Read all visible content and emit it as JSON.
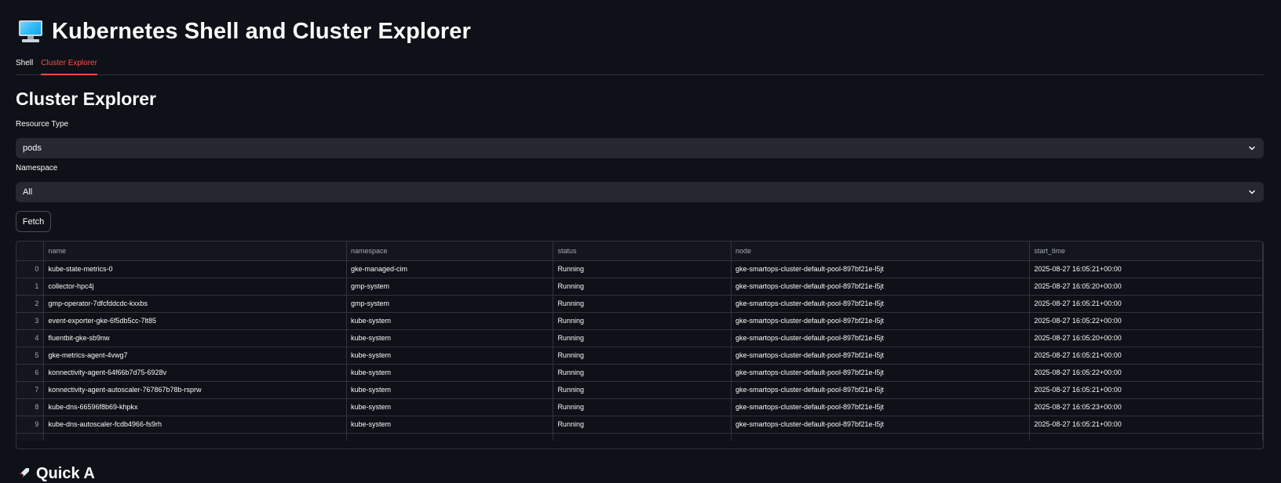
{
  "app": {
    "title": "Kubernetes Shell and Cluster Explorer",
    "icon": "monitor-icon"
  },
  "tabs": [
    {
      "label": "Shell",
      "active": false
    },
    {
      "label": "Cluster Explorer",
      "active": true
    }
  ],
  "explorer": {
    "heading": "Cluster Explorer",
    "resource_type": {
      "label": "Resource Type",
      "value": "pods"
    },
    "namespace": {
      "label": "Namespace",
      "value": "All"
    },
    "fetch_label": "Fetch"
  },
  "table": {
    "columns": [
      "name",
      "namespace",
      "status",
      "node",
      "start_time"
    ],
    "rows": [
      {
        "index": "0",
        "name": "kube-state-metrics-0",
        "namespace": "gke-managed-cim",
        "status": "Running",
        "node": "gke-smartops-cluster-default-pool-897bf21e-l5jt",
        "start_time": "2025-08-27 16:05:21+00:00"
      },
      {
        "index": "1",
        "name": "collector-hpc4j",
        "namespace": "gmp-system",
        "status": "Running",
        "node": "gke-smartops-cluster-default-pool-897bf21e-l5jt",
        "start_time": "2025-08-27 16:05:20+00:00"
      },
      {
        "index": "2",
        "name": "gmp-operator-7dfcfddcdc-kxxbs",
        "namespace": "gmp-system",
        "status": "Running",
        "node": "gke-smartops-cluster-default-pool-897bf21e-l5jt",
        "start_time": "2025-08-27 16:05:21+00:00"
      },
      {
        "index": "3",
        "name": "event-exporter-gke-6f5db5cc-7lt85",
        "namespace": "kube-system",
        "status": "Running",
        "node": "gke-smartops-cluster-default-pool-897bf21e-l5jt",
        "start_time": "2025-08-27 16:05:22+00:00"
      },
      {
        "index": "4",
        "name": "fluentbit-gke-sb9nw",
        "namespace": "kube-system",
        "status": "Running",
        "node": "gke-smartops-cluster-default-pool-897bf21e-l5jt",
        "start_time": "2025-08-27 16:05:20+00:00"
      },
      {
        "index": "5",
        "name": "gke-metrics-agent-4vwg7",
        "namespace": "kube-system",
        "status": "Running",
        "node": "gke-smartops-cluster-default-pool-897bf21e-l5jt",
        "start_time": "2025-08-27 16:05:21+00:00"
      },
      {
        "index": "6",
        "name": "konnectivity-agent-64f66b7d75-6928v",
        "namespace": "kube-system",
        "status": "Running",
        "node": "gke-smartops-cluster-default-pool-897bf21e-l5jt",
        "start_time": "2025-08-27 16:05:22+00:00"
      },
      {
        "index": "7",
        "name": "konnectivity-agent-autoscaler-767867b78b-rsprw",
        "namespace": "kube-system",
        "status": "Running",
        "node": "gke-smartops-cluster-default-pool-897bf21e-l5jt",
        "start_time": "2025-08-27 16:05:21+00:00"
      },
      {
        "index": "8",
        "name": "kube-dns-66596f8b69-khpkx",
        "namespace": "kube-system",
        "status": "Running",
        "node": "gke-smartops-cluster-default-pool-897bf21e-l5jt",
        "start_time": "2025-08-27 16:05:23+00:00"
      },
      {
        "index": "9",
        "name": "kube-dns-autoscaler-fcdb4966-fs9rh",
        "namespace": "kube-system",
        "status": "Running",
        "node": "gke-smartops-cluster-default-pool-897bf21e-l5jt",
        "start_time": "2025-08-27 16:05:21+00:00"
      }
    ]
  },
  "next_section": {
    "heading": "Quick A",
    "icon": "rocket-icon"
  },
  "colors": {
    "background": "#0e1117",
    "accent": "#ff4b4b",
    "input_bg": "#262730",
    "border": "#31333f"
  }
}
